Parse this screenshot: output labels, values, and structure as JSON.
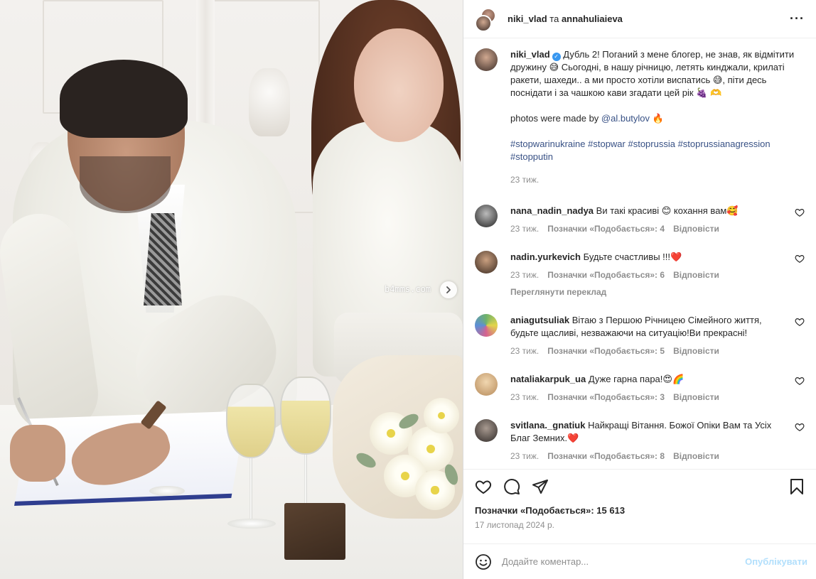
{
  "post": {
    "header": {
      "user1": "niki_vlad",
      "and": "та",
      "user2": "annahuliaieva"
    },
    "caption": {
      "username": "niki_vlad",
      "line1": "Дубль 2! Поганий з мене блогер, не знав, як відмітити дружину 😅 Сьогодні, в нашу річницю, летять кинджали, крилаті ракети, шахеди.. а ми просто хотіли виспатись 😅, піти десь поснідати і за чашкою кави згадати цей рік 🍇 🫶",
      "photos_prefix": "photos were made by",
      "photos_mention": "@al.butylov",
      "photos_suffix": "🔥",
      "hashtags": "#stopwarinukraine #stopwar #stoprussia #stoprussianagression #stopputin",
      "time": "23 тиж."
    },
    "comments": [
      {
        "username": "nana_nadin_nadya",
        "text": "Ви такі красиві 😊 кохання вам🥰",
        "time": "23 тиж.",
        "likes": "Позначки «Подобається»: 4",
        "reply": "Відповісти",
        "translate": ""
      },
      {
        "username": "nadin.yurkevich",
        "text": "Будьте счастливы !!!❤️",
        "time": "23 тиж.",
        "likes": "Позначки «Подобається»: 6",
        "reply": "Відповісти",
        "translate": "Переглянути переклад"
      },
      {
        "username": "aniagutsuliak",
        "text": "Вітаю з Першою Річницею Сімейного життя, будьте щасливі, незважаючи на ситуацію!Ви прекрасні!",
        "time": "23 тиж.",
        "likes": "Позначки «Подобається»: 5",
        "reply": "Відповісти",
        "translate": ""
      },
      {
        "username": "nataliakarpuk_ua",
        "text": "Дуже гарна пара!😍🌈",
        "time": "23 тиж.",
        "likes": "Позначки «Подобається»: 3",
        "reply": "Відповісти",
        "translate": ""
      },
      {
        "username": "svitlana._gnatiuk",
        "text": "Найкращі Вітання. Божої Опіки Вам та Усіх Благ Земних.❤️",
        "time": "23 тиж.",
        "likes": "Позначки «Подобається»: 8",
        "reply": "Відповісти",
        "translate": ""
      }
    ],
    "likes_total": "Позначки «Подобається»: 15 613",
    "date": "17 листопад 2024 р.",
    "add_comment": {
      "placeholder": "Додайте коментар...",
      "post_label": "Опублікувати"
    },
    "watermark": "b4mms.com",
    "icons": {
      "more": "more-options-icon",
      "like": "heart-icon",
      "comment": "comment-icon",
      "share": "share-icon",
      "save": "bookmark-icon",
      "emoji": "emoji-icon",
      "next": "chevron-right-icon"
    },
    "colors": {
      "link": "#385185",
      "muted": "#8e8e8e",
      "verified": "#3897f0",
      "post_disabled": "#b2dffc"
    }
  }
}
